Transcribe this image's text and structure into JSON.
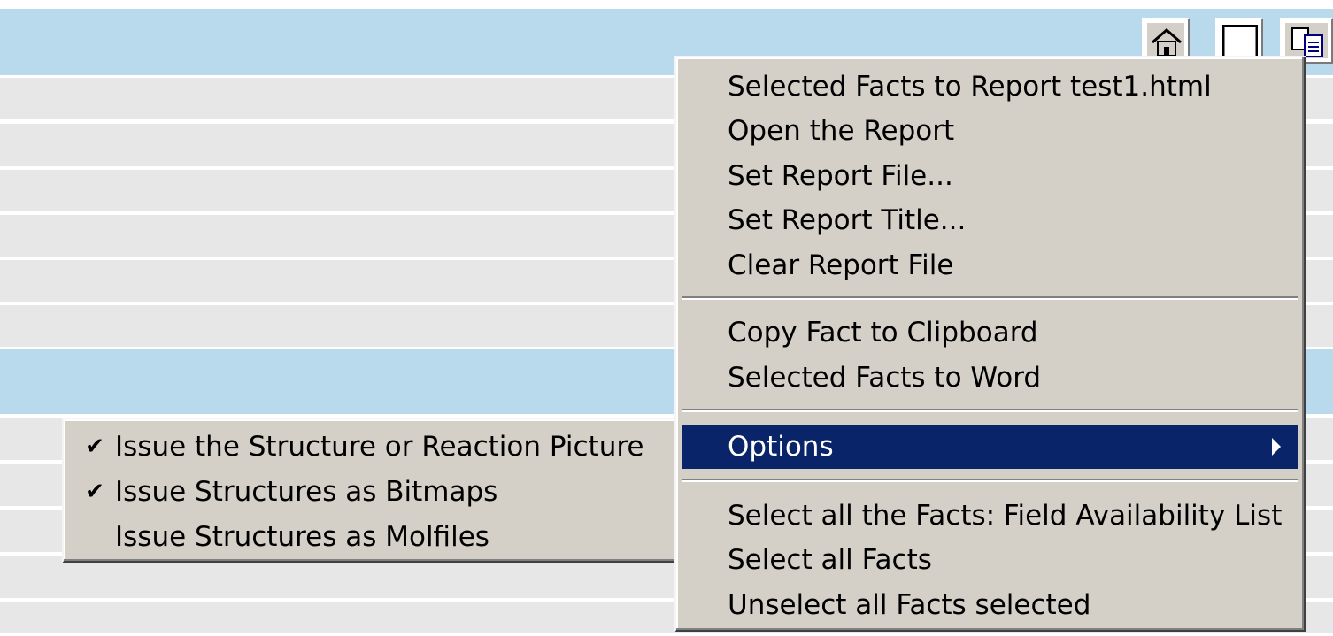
{
  "toolbar": {
    "icons": [
      "home-icon",
      "window-icon",
      "copy-icon"
    ]
  },
  "context_menu": {
    "items": [
      {
        "label": "Selected Facts to Report test1.html"
      },
      {
        "label": "Open the Report"
      },
      {
        "label": "Set Report File..."
      },
      {
        "label": "Set Report Title..."
      },
      {
        "label": "Clear Report File"
      },
      {
        "label": "Copy Fact to Clipboard"
      },
      {
        "label": "Selected Facts to Word"
      },
      {
        "label": "Options",
        "highlighted": true,
        "has_submenu": true
      },
      {
        "label": "Select all the Facts: Field Availability List"
      },
      {
        "label": "Select all Facts"
      },
      {
        "label": "Unselect all Facts selected"
      }
    ]
  },
  "options_submenu": {
    "items": [
      {
        "label": "Issue the Structure or Reaction Picture",
        "checked": true
      },
      {
        "label": "Issue Structures as Bitmaps",
        "checked": true
      },
      {
        "label": "Issue Structures as Molfiles",
        "checked": false
      }
    ]
  },
  "colors": {
    "band_blue": "#b9d9ec",
    "row_stripe": "#e7e7e7",
    "menu_bg": "#d4d0c8",
    "highlight": "#0a246a"
  }
}
